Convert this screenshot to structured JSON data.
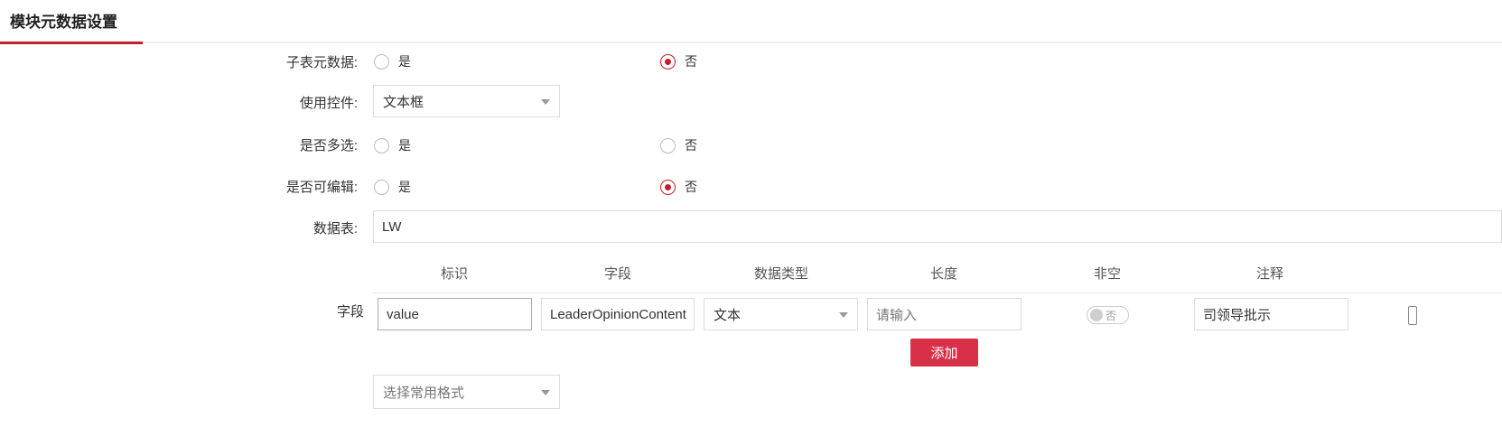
{
  "header": {
    "title": "模块元数据设置"
  },
  "form": {
    "subtable_meta": {
      "label": "子表元数据:",
      "yes": "是",
      "no": "否",
      "selected": "否"
    },
    "control": {
      "label": "使用控件:",
      "value": "文本框"
    },
    "multi_select": {
      "label": "是否多选:",
      "yes": "是",
      "no": "否",
      "selected": ""
    },
    "editable": {
      "label": "是否可编辑:",
      "yes": "是",
      "no": "否",
      "selected": "否"
    },
    "data_table": {
      "label": "数据表:",
      "value": "LW"
    },
    "fields": {
      "label": "字段",
      "columns": [
        "标识",
        "字段",
        "数据类型",
        "长度",
        "非空",
        "注释"
      ],
      "row": {
        "id": "value",
        "field": "LeaderOpinionContent",
        "data_type": "文本",
        "length_placeholder": "请输入",
        "not_null": "否",
        "comment": "司领导批示"
      },
      "add_button": "添加"
    },
    "format_select": {
      "placeholder": "选择常用格式"
    }
  },
  "colors": {
    "accent": "#c0202a",
    "button": "#d9304a"
  }
}
